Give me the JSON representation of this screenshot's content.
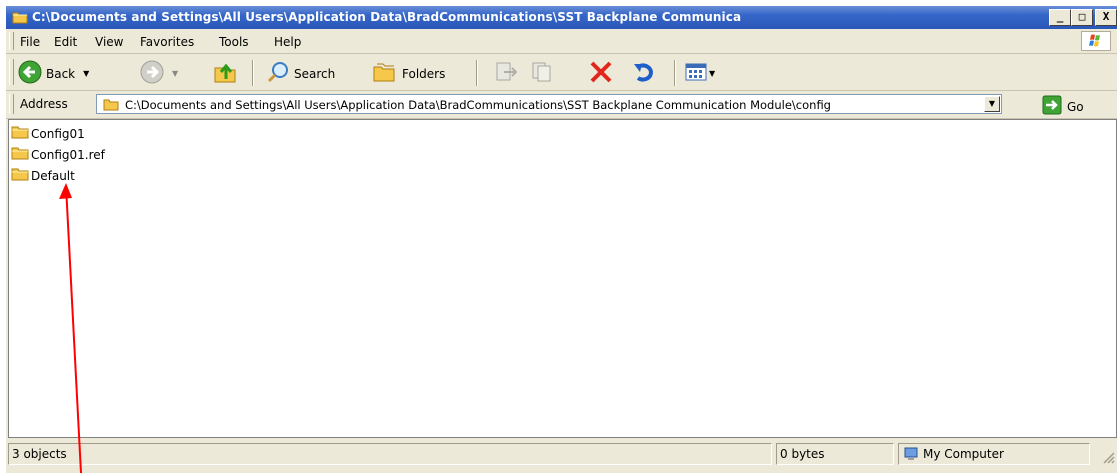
{
  "window": {
    "title": "C:\\Documents and Settings\\All Users\\Application Data\\BradCommunications\\SST Backplane Communica",
    "minimize_glyph": "_",
    "maximize_glyph": "□",
    "close_glyph": "X"
  },
  "menu": {
    "items": [
      {
        "label": "File"
      },
      {
        "label": "Edit"
      },
      {
        "label": "View"
      },
      {
        "label": "Favorites"
      },
      {
        "label": "Tools"
      },
      {
        "label": "Help"
      }
    ]
  },
  "toolbar": {
    "back_label": "Back",
    "search_label": "Search",
    "folders_label": "Folders"
  },
  "address": {
    "label": "Address",
    "value": "C:\\Documents and Settings\\All Users\\Application Data\\BradCommunications\\SST Backplane Communication Module\\config",
    "go_label": "Go"
  },
  "files": [
    {
      "name": "Config01",
      "icon": "folder-icon"
    },
    {
      "name": "Config01.ref",
      "icon": "folder-icon"
    },
    {
      "name": "Default",
      "icon": "folder-icon"
    }
  ],
  "status": {
    "objects": "3 objects",
    "size": "0 bytes",
    "zone": "My Computer"
  },
  "colors": {
    "titlebar": "#2a58b8",
    "chrome": "#ece9d8",
    "annotation_arrow": "#ff0000",
    "folder": "#f5c84c"
  }
}
